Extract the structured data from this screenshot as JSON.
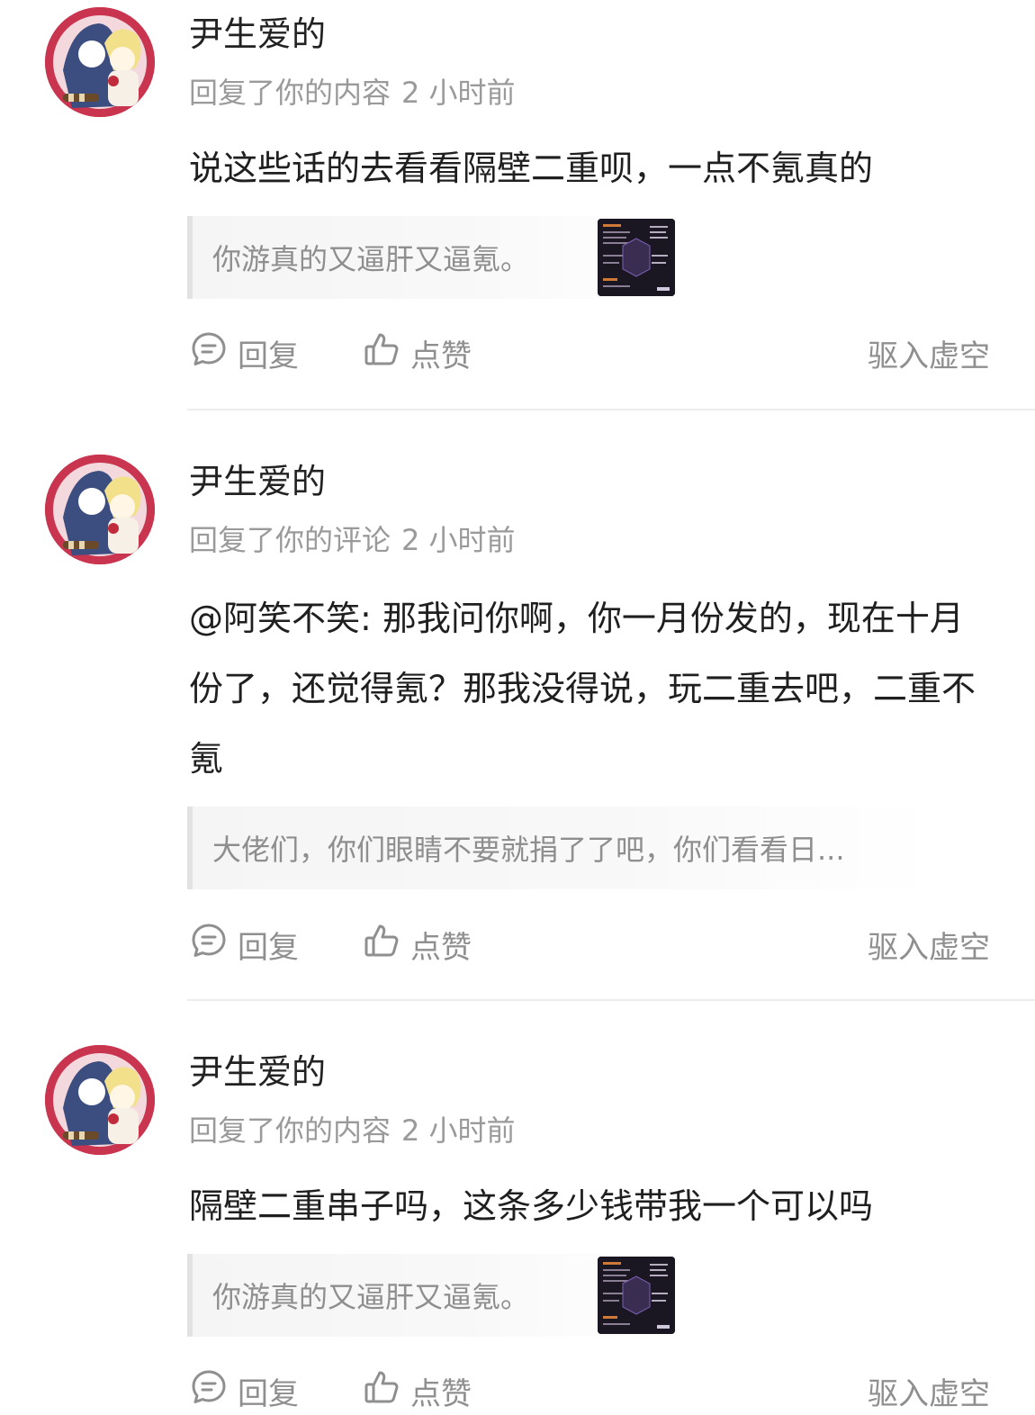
{
  "notifications": [
    {
      "username": "尹生爱的",
      "action": "回复了你的内容",
      "time": "2 小时前",
      "content": "说这些话的去看看隔壁二重呗，一点不氪真的",
      "quote": "你游真的又逼肝又逼氪。",
      "has_thumbnail": true,
      "buttons": {
        "reply": "回复",
        "like": "点赞",
        "right": "驱入虚空"
      }
    },
    {
      "username": "尹生爱的",
      "action": "回复了你的评论",
      "time": "2 小时前",
      "content": "@阿笑不笑: 那我问你啊，你一月份发的，现在十月份了，还觉得氪？那我没得说，玩二重去吧，二重不氪",
      "quote": "大佬们，你们眼睛不要就捐了了吧，你们看看日...",
      "has_thumbnail": false,
      "buttons": {
        "reply": "回复",
        "like": "点赞",
        "right": "驱入虚空"
      }
    },
    {
      "username": "尹生爱的",
      "action": "回复了你的内容",
      "time": "2 小时前",
      "content": "隔壁二重串子吗，这条多少钱带我一个可以吗",
      "quote": "你游真的又逼肝又逼氪。",
      "has_thumbnail": true,
      "buttons": {
        "reply": "回复",
        "like": "点赞",
        "right": "驱入虚空"
      }
    }
  ],
  "icons": {
    "reply": "comment-bubble-icon",
    "like": "thumbs-up-icon"
  },
  "colors": {
    "avatar_ring": "#c9344f",
    "meta_text": "#9a9a9a",
    "action_text": "#8f8f8f"
  }
}
